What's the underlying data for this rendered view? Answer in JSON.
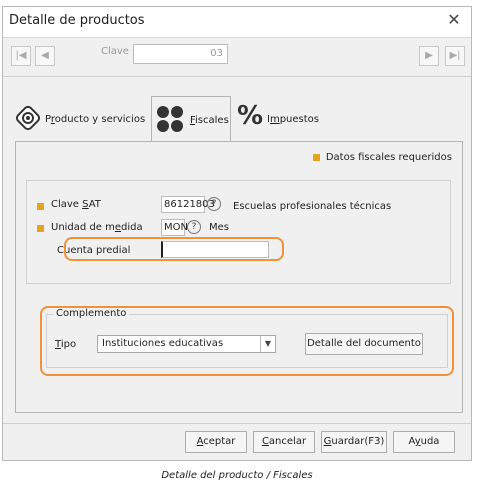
{
  "window": {
    "title": "Detalle de productos"
  },
  "nav": {
    "clave_label": "Clave",
    "clave_value": "03",
    "icons": [
      "first-icon",
      "prev-icon",
      "next-icon",
      "last-icon"
    ]
  },
  "tabs": [
    {
      "prefix": "P",
      "mnemonic": "r",
      "suffix": "oducto y servicios",
      "icon": "gear-cart-icon"
    },
    {
      "prefix": "",
      "mnemonic": "F",
      "suffix": "iscales",
      "icon": "dots-icon",
      "active": true
    },
    {
      "prefix": "I",
      "mnemonic": "m",
      "suffix": "puestos",
      "icon": "percent-icon"
    }
  ],
  "fiscal": {
    "required_note": "Datos fiscales requeridos",
    "clave_sat": {
      "prefix": "Clave ",
      "mnemonic": "S",
      "suffix": "AT",
      "value": "86121803",
      "description": "Escuelas profesionales técnicas"
    },
    "unidad": {
      "prefix": "Unidad de m",
      "mnemonic": "e",
      "suffix": "dida",
      "value": "MON",
      "description": "Mes"
    },
    "cuenta_predial": {
      "label": "Cuenta predial",
      "value": ""
    }
  },
  "complemento": {
    "legend": "Complemento",
    "tipo_mnemonic": "T",
    "tipo_suffix": "ipo",
    "tipo_value": "Instituciones educativas",
    "detalle_button": "Detalle del documento"
  },
  "footer": {
    "aceptar": {
      "mnemonic": "A",
      "suffix": "ceptar"
    },
    "cancelar": {
      "mnemonic": "C",
      "suffix": "ancelar"
    },
    "guardar": {
      "mnemonic": "G",
      "suffix": "uardar(F3)"
    },
    "ayuda": {
      "prefix": "A",
      "mnemonic": "y",
      "suffix": "uda"
    }
  },
  "caption": "Detalle del producto / Fiscales",
  "colors": {
    "accent": "#f0923a",
    "required": "#e8a21c"
  }
}
